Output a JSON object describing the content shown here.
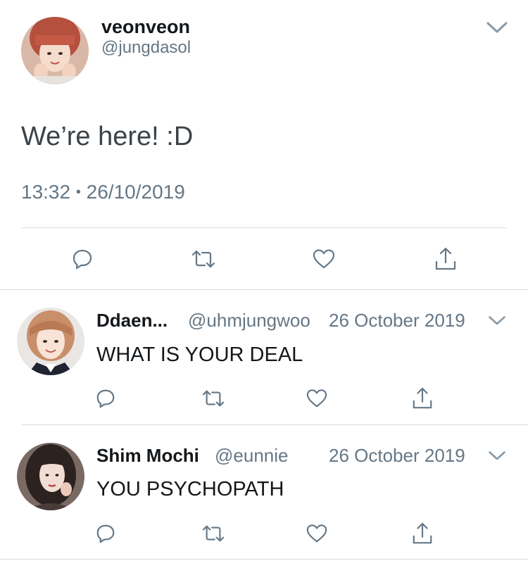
{
  "main_tweet": {
    "display_name": "veonveon",
    "handle": "@jungdasol",
    "text": "We’re here! :D",
    "time": "13:32",
    "separator": "•",
    "date": "26/10/2019"
  },
  "replies": [
    {
      "display_name": "Ddaen...",
      "handle": "@uhmjungwoo",
      "date": "26 October 2019",
      "text": "WHAT IS YOUR DEAL"
    },
    {
      "display_name": "Shim Mochi",
      "handle": "@eunnie",
      "date": "26 October 2019",
      "text": "YOU PSYCHOPATH"
    }
  ],
  "icons": {
    "reply": "reply-icon",
    "retweet": "retweet-icon",
    "like": "heart-icon",
    "share": "share-icon",
    "menu": "chevron-down-icon"
  },
  "colors": {
    "text": "#14171a",
    "secondary": "#657786",
    "divider": "#d9dee2",
    "icon": "#657786"
  }
}
